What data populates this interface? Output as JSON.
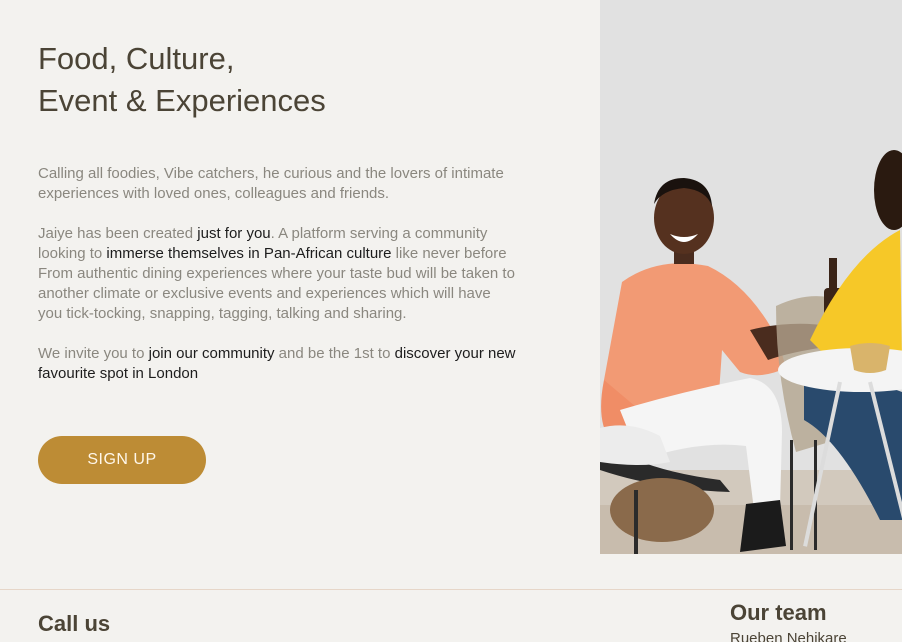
{
  "hero": {
    "title_line1": "Food, Culture,",
    "title_line2": "Event & Experiences",
    "para1": "Calling all foodies, Vibe catchers, he curious and the lovers of intimate experiences with loved ones, colleagues and friends.",
    "para2": {
      "t1": "Jaiye has been created ",
      "h1": "just for you",
      "t2": ". A platform serving a community looking to ",
      "h2": "immerse themselves in Pan-African culture",
      "t3": " like never before From authentic dining experiences where your taste bud will be taken to another climate or exclusive events and experiences which will have you tick-tocking, snapping, tagging, talking and sharing."
    },
    "para3": {
      "t1": "We invite you to ",
      "h1": "join our community",
      "t2": " and be the 1st to ",
      "h2": "discover your new favourite spot in London"
    },
    "signup_label": "SIGN UP"
  },
  "footer": {
    "call_heading": "Call us",
    "team_heading": "Our team",
    "team_member": "Rueben Nehikare"
  },
  "colors": {
    "background": "#f3f2ef",
    "heading": "#4b4436",
    "body_text": "#8a877f",
    "highlight_text": "#1d1d1d",
    "accent_button": "#bd8c35",
    "divider": "#e6d6c8"
  }
}
